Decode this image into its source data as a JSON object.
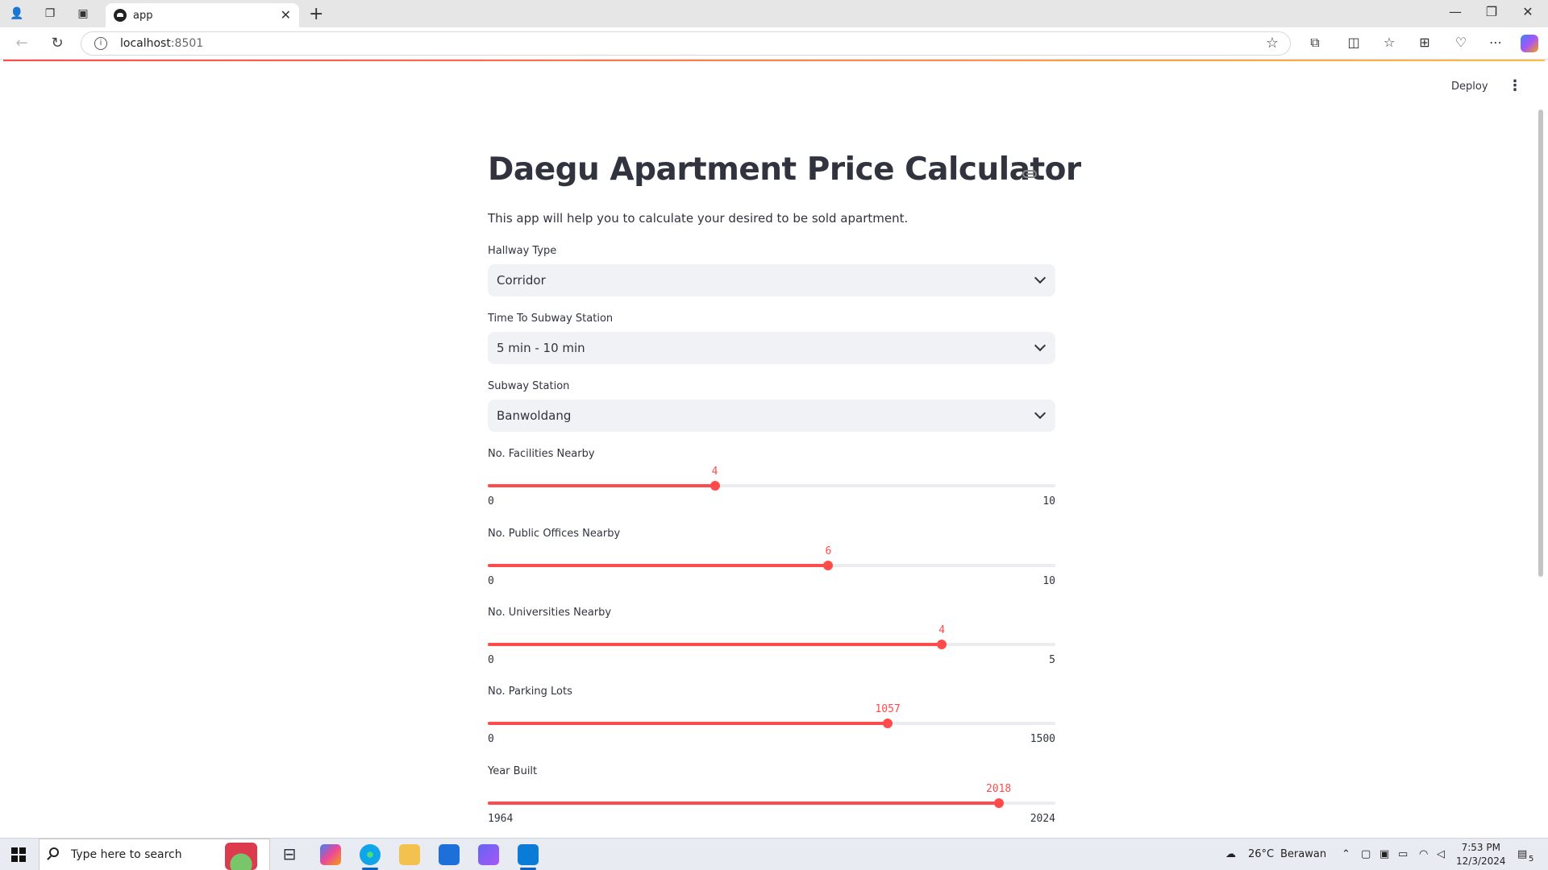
{
  "browser": {
    "tab_title": "app",
    "url_host": "localhost",
    "url_port": ":8501",
    "new_tab": "+",
    "close_tab": "✕"
  },
  "app": {
    "deploy_label": "Deploy",
    "title": "Daegu Apartment Price Calculator",
    "subtitle": "This app will help you to calculate your desired to be sold apartment.",
    "selects": [
      {
        "label": "Hallway Type",
        "value": "Corridor"
      },
      {
        "label": "Time To Subway Station",
        "value": "5 min - 10 min"
      },
      {
        "label": "Subway Station",
        "value": "Banwoldang"
      }
    ],
    "sliders": [
      {
        "label": "No. Facilities Nearby",
        "value": "4",
        "min": "0",
        "max": "10",
        "fraction": 0.4
      },
      {
        "label": "No. Public Offices Nearby",
        "value": "6",
        "min": "0",
        "max": "10",
        "fraction": 0.6
      },
      {
        "label": "No. Universities Nearby",
        "value": "4",
        "min": "0",
        "max": "5",
        "fraction": 0.8
      },
      {
        "label": "No. Parking Lots",
        "value": "1057",
        "min": "0",
        "max": "1500",
        "fraction": 0.7047
      },
      {
        "label": "Year Built",
        "value": "2018",
        "min": "1964",
        "max": "2024",
        "fraction": 0.9
      }
    ],
    "accent_color": "#ff4b4b"
  },
  "taskbar": {
    "search_placeholder": "Type here to search",
    "weather_temp": "26°C",
    "weather_desc": "Berawan",
    "time": "7:53 PM",
    "date": "12/3/2024",
    "notification_count": "5"
  }
}
